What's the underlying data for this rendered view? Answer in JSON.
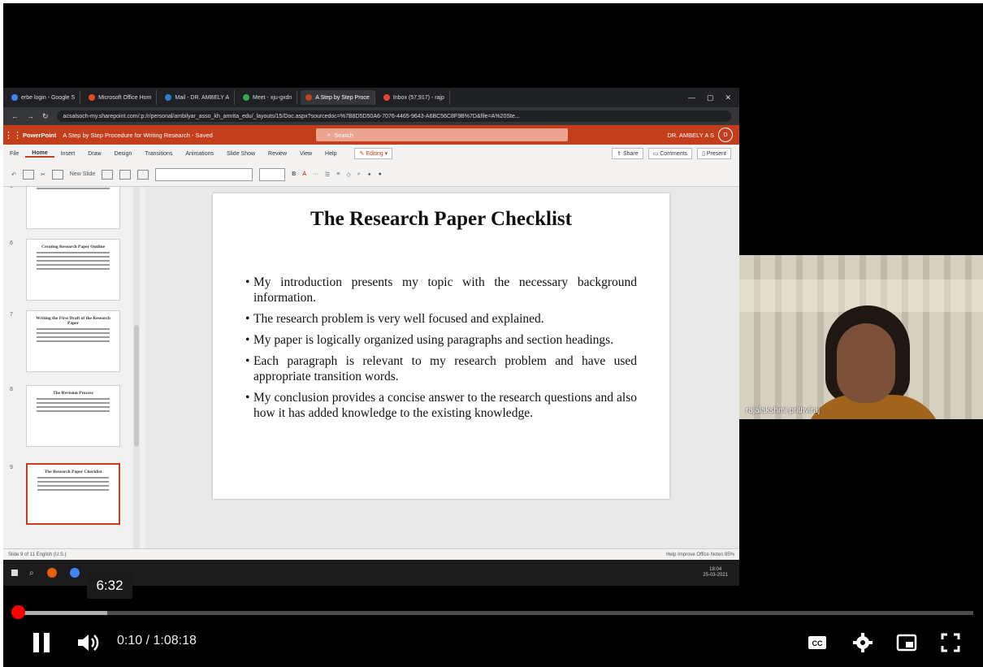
{
  "browser": {
    "tabs": [
      {
        "label": "erbe login - Google S",
        "color": "#4285f4"
      },
      {
        "label": "Microsoft Office Hom",
        "color": "#e64a19"
      },
      {
        "label": "Mail - DR. AMBELY A",
        "color": "#2b7cd3"
      },
      {
        "label": "Meet - xju-gxdn",
        "color": "#34a853"
      },
      {
        "label": "A Step by Step Proce",
        "color": "#c43e1c",
        "active": true
      },
      {
        "label": "Inbox (57,917) - rajp",
        "color": "#ea4335"
      }
    ],
    "url": "acsalsoch-my.sharepoint.com/:p:/r/personal/ambilyar_asso_kh_amrita_edu/_layouts/15/Doc.aspx?sourcedoc=%7B8D5D50A6-7076-4465-9643-A6BC56C8F9B%7D&file=A%20Ste..."
  },
  "powerpoint": {
    "app_name": "PowerPoint",
    "doc_title": "A Step by Step Procedure for Writing Research - Saved",
    "search_placeholder": "Search",
    "user_name": "DR. AMBELY A S",
    "user_initial": "D",
    "menu": [
      "File",
      "Home",
      "Insert",
      "Draw",
      "Design",
      "Transitions",
      "Animations",
      "Slide Show",
      "Review",
      "View",
      "Help"
    ],
    "editing_label": "Editing",
    "share_label": "Share",
    "comments_label": "Comments",
    "present_label": "Present",
    "new_slide_label": "New Slide"
  },
  "thumbnails": [
    {
      "num": "5",
      "title": ""
    },
    {
      "num": "6",
      "title": "Creating Research Paper Outline"
    },
    {
      "num": "7",
      "title": "Writing the First Draft of the Research Paper"
    },
    {
      "num": "8",
      "title": "The Revision Process"
    },
    {
      "num": "9",
      "title": "The Research Paper Checklist",
      "selected": true
    }
  ],
  "slide": {
    "title": "The Research Paper Checklist",
    "bullets": [
      "My introduction presents my topic with the necessary background information.",
      "The research problem is very well focused and explained.",
      "My paper is logically organized using paragraphs and section headings.",
      "Each paragraph is relevant to my research problem and  have used appropriate transition words.",
      "My conclusion provides a concise answer to the research questions and also how it has added knowledge to the existing knowledge."
    ]
  },
  "statusbar": {
    "left": "Slide 9 of 11   English (U.S.)",
    "right": "Help Improve Office   Notes   85%"
  },
  "taskbar": {
    "time": "18:04",
    "date": "25-03-2021"
  },
  "camera": {
    "participant_name": "rajalakshmi prithviraj"
  },
  "player": {
    "preview_time": "6:32",
    "current_time": "0:10",
    "duration": "1:08:18",
    "time_display": "0:10 / 1:08:18",
    "played_fraction": 0.0024,
    "buffered_fraction": 0.095,
    "accent_color": "#ff0000"
  }
}
